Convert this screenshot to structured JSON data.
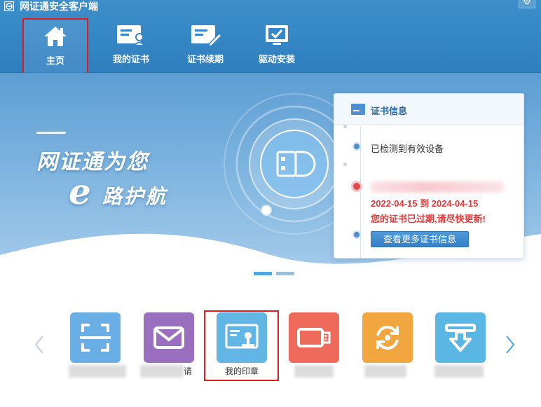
{
  "window": {
    "title": "网证通安全客户端",
    "settings_icon": "gear-icon"
  },
  "nav": {
    "items": [
      {
        "label": "主页",
        "icon": "home-icon",
        "active": true
      },
      {
        "label": "我的证书",
        "icon": "certificate-user-icon",
        "active": false
      },
      {
        "label": "证书续期",
        "icon": "certificate-renew-icon",
        "active": false
      },
      {
        "label": "驱动安装",
        "icon": "driver-install-icon",
        "active": false
      }
    ]
  },
  "banner": {
    "slogan_line1": "网证通为您",
    "slogan_e": "e",
    "slogan_line2": "路护航",
    "slide_count": 2,
    "active_slide": 1
  },
  "cert_card": {
    "title": "证书信息",
    "detected": "已检测到有效设备",
    "validity": "2022-04-15 到 2024-04-15",
    "expired_notice": "您的证书已过期,请尽快更新!",
    "more_button": "查看更多证书信息"
  },
  "tiles": [
    {
      "label": "",
      "icon": "scan-icon",
      "color": "#6aaee6"
    },
    {
      "label": "请",
      "icon": "mail-icon",
      "color": "#9a6fbf"
    },
    {
      "label": "我的印章",
      "icon": "seal-icon",
      "color": "#62b6e3"
    },
    {
      "label": "",
      "icon": "usb-key-icon",
      "color": "#ee6a5a"
    },
    {
      "label": "",
      "icon": "sync-icon",
      "color": "#f2a640"
    },
    {
      "label": "",
      "icon": "download-icon",
      "color": "#5ab6e3"
    }
  ],
  "colors": {
    "nav_bg": "#3688c8",
    "accent": "#3680c6",
    "alert": "#e03a3a",
    "highlight_box": "#e11b1b"
  }
}
